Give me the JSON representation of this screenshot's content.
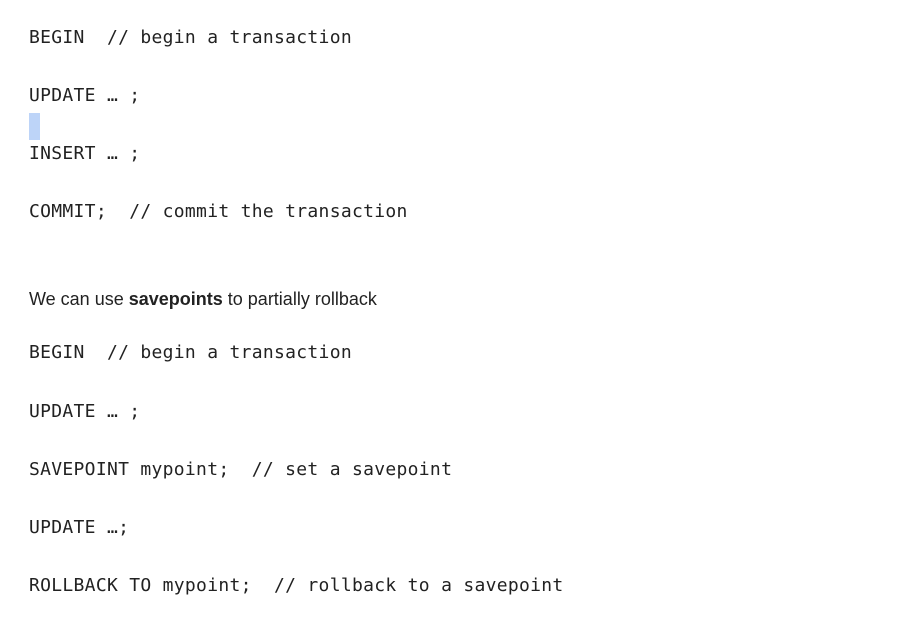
{
  "block1": [
    "BEGIN  // begin a transaction",
    "UPDATE … ;",
    "INSERT … ;",
    "COMMIT;  // commit the transaction"
  ],
  "prose": {
    "before": "We can use ",
    "bold": "savepoints",
    "after": " to partially rollback"
  },
  "block2": [
    "BEGIN  // begin a transaction",
    "UPDATE … ;",
    "SAVEPOINT mypoint;  // set a savepoint",
    "UPDATE …;",
    "ROLLBACK TO mypoint;  // rollback to a savepoint"
  ]
}
